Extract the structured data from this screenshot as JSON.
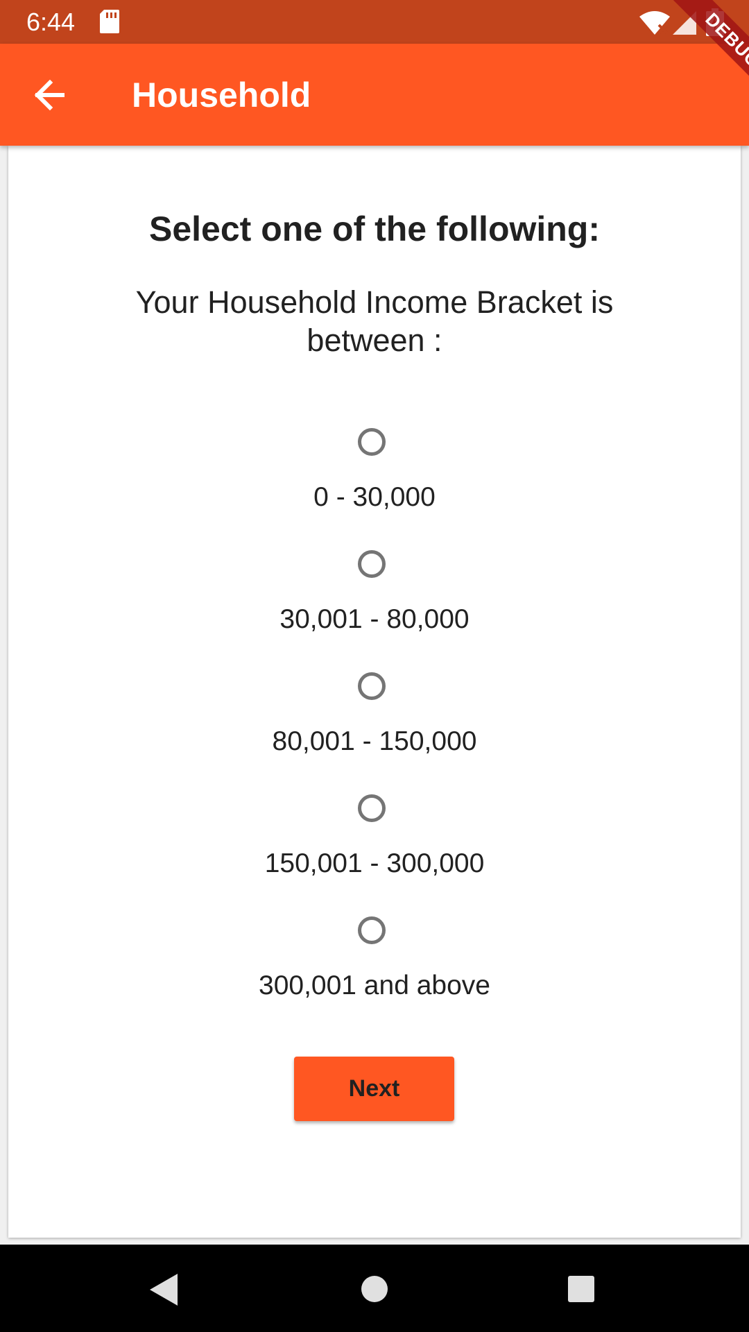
{
  "status_bar": {
    "time": "6:44",
    "icons": [
      "sd-card-icon",
      "wifi-icon",
      "cell-signal-icon",
      "battery-icon"
    ]
  },
  "app_bar": {
    "title": "Household",
    "back_icon": "arrow-back-icon"
  },
  "debug_banner": "DEBUG",
  "form": {
    "heading": "Select one of the following:",
    "question": "Your Household Income Bracket is between :",
    "options": [
      {
        "label": "0 - 30,000",
        "selected": false
      },
      {
        "label": "30,001 - 80,000",
        "selected": false
      },
      {
        "label": "80,001 - 150,000",
        "selected": false
      },
      {
        "label": "150,001 - 300,000",
        "selected": false
      },
      {
        "label": "300,001 and above",
        "selected": false
      }
    ],
    "next_label": "Next"
  },
  "navigation_bar": {
    "icons": [
      "nav-back-icon",
      "nav-home-icon",
      "nav-recents-icon"
    ]
  },
  "colors": {
    "primary": "#ff5722",
    "status_bar": "#c1441c",
    "radio": "#757575"
  }
}
